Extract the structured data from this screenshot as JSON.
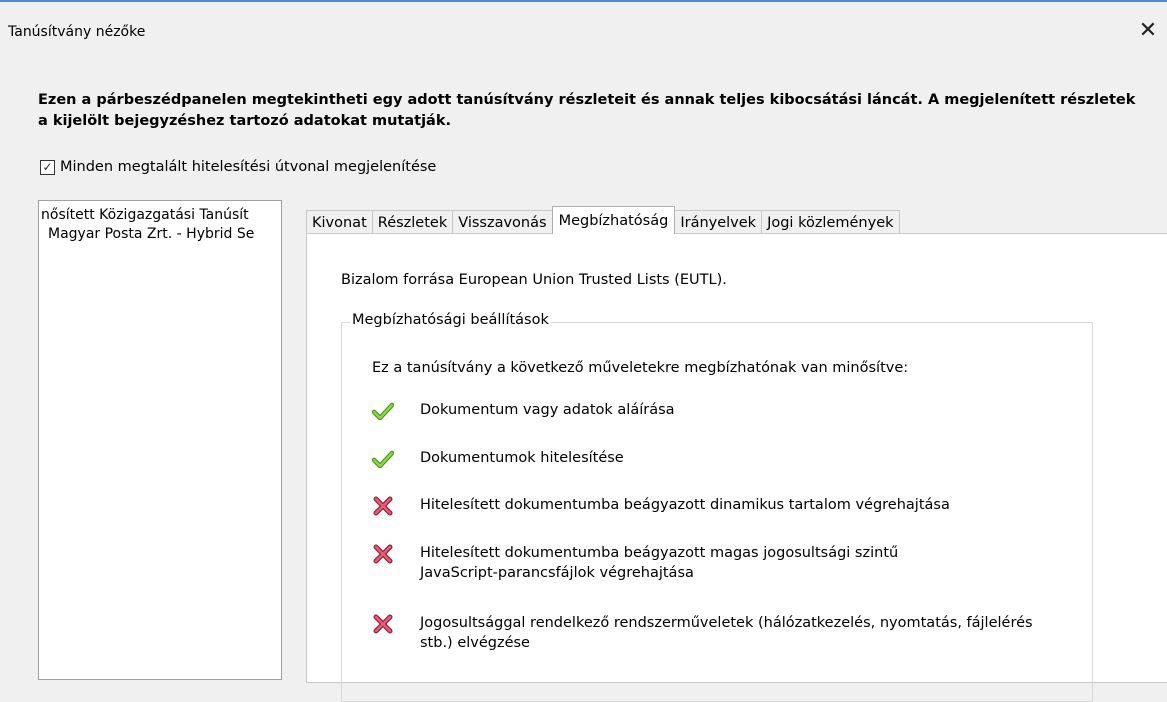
{
  "window": {
    "title": "Tanúsítvány nézőke",
    "close_glyph": "✕"
  },
  "intro": "Ezen a párbeszédpanelen megtekintheti egy adott tanúsítvány részleteit és annak teljes kibocsátási láncát. A megjelenített részletek a kijelölt bejegyzéshez tartozó adatokat mutatják.",
  "show_all_paths": {
    "checked": true,
    "check_glyph": "✓",
    "label": "Minden megtalált hitelesítési útvonal megjelenítése"
  },
  "tree": {
    "items": [
      {
        "label": "nősített Közigazgatási Tanúsít"
      },
      {
        "label": "Magyar Posta Zrt. - Hybrid Se"
      }
    ]
  },
  "tabs": [
    {
      "label": "Kivonat",
      "active": false
    },
    {
      "label": "Részletek",
      "active": false
    },
    {
      "label": "Visszavonás",
      "active": false
    },
    {
      "label": "Megbízhatóság",
      "active": true
    },
    {
      "label": "Irányelvek",
      "active": false
    },
    {
      "label": "Jogi közlemények",
      "active": false
    }
  ],
  "trust": {
    "source": "Bizalom forrása European Union Trusted Lists (EUTL).",
    "group_title": "Megbízhatósági beállítások",
    "description": "Ez a tanúsítvány a következő műveletekre megbízhatónak van minősítve:",
    "permissions": [
      {
        "label": "Dokumentum vagy adatok aláírása",
        "allowed": true,
        "icon": "check-icon"
      },
      {
        "label": "Dokumentumok hitelesítése",
        "allowed": true,
        "icon": "check-icon"
      },
      {
        "label": "Hitelesített dokumentumba beágyazott dinamikus tartalom végrehajtása",
        "allowed": false,
        "icon": "cross-icon"
      },
      {
        "label": "Hitelesített dokumentumba beágyazott magas jogosultsági szintű JavaScript-parancsfájlok végrehajtása",
        "allowed": false,
        "icon": "cross-icon"
      },
      {
        "label": "Jogosultsággal rendelkező rendszerműveletek (hálózatkezelés, nyomtatás, fájlelérés stb.) elvégzése",
        "allowed": false,
        "icon": "cross-icon"
      }
    ]
  },
  "colors": {
    "title_accent": "#4a8bd6",
    "check_green": "#6cc12a",
    "cross_red": "#c8324a"
  }
}
